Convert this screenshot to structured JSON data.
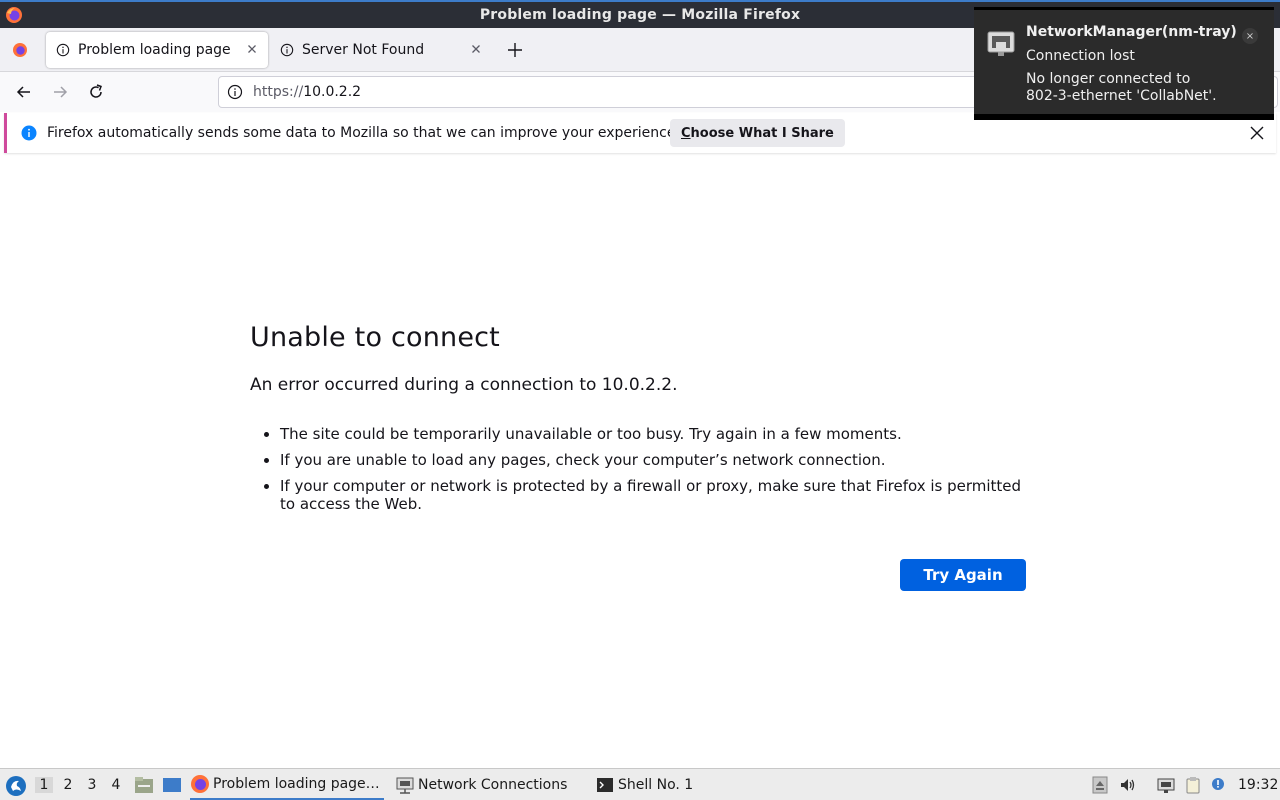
{
  "window": {
    "title": "Problem loading page — Mozilla Firefox"
  },
  "tabs": [
    {
      "label": "Problem loading page",
      "active": true,
      "icon": "info-icon"
    },
    {
      "label": "Server Not Found",
      "active": false,
      "icon": "info-icon"
    }
  ],
  "urlbar": {
    "scheme": "https://",
    "host": "10.0.2.2"
  },
  "infobar": {
    "message": "Firefox automatically sends some data to Mozilla so that we can improve your experience.",
    "button_prefix": "C",
    "button_rest": "hoose What I Share"
  },
  "error": {
    "title": "Unable to connect",
    "description": "An error occurred during a connection to 10.0.2.2.",
    "items": [
      "The site could be temporarily unavailable or too busy. Try again in a few moments.",
      "If you are unable to load any pages, check your computer’s network connection.",
      "If your computer or network is protected by a firewall or proxy, make sure that Firefox is permitted to access the Web."
    ],
    "button": "Try Again"
  },
  "notification": {
    "app": "NetworkManager(nm-tray)",
    "summary": "Connection lost",
    "body_line1": "No longer connected to",
    "body_line2": "802-3-ethernet 'CollabNet'.",
    "close": "×"
  },
  "taskbar": {
    "workspaces": [
      "1",
      "2",
      "3",
      "4"
    ],
    "tasks": [
      {
        "label": "Problem loading page…",
        "icon": "firefox-icon",
        "active": true
      },
      {
        "label": "Network Connections",
        "icon": "network-icon",
        "active": false
      },
      {
        "label": "Shell No. 1",
        "icon": "terminal-icon",
        "active": false
      }
    ],
    "clock": "19:32"
  },
  "colors": {
    "accent": "#0061e0",
    "titlebar": "#2b2e36",
    "infobar_stripe": "#cf4a9c"
  }
}
